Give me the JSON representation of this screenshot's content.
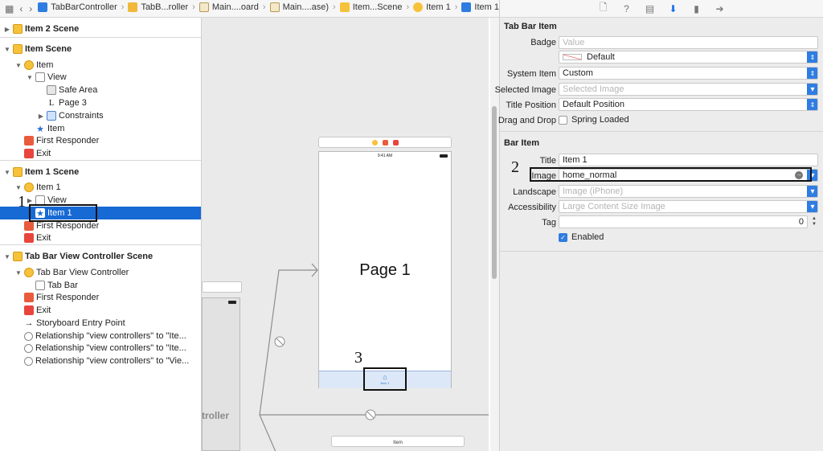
{
  "toolbar": {
    "breadcrumbs": [
      {
        "label": "TabBarController",
        "icon": "project-icon"
      },
      {
        "label": "TabB...roller",
        "icon": "folder-icon"
      },
      {
        "label": "Main....oard",
        "icon": "storyboard-icon"
      },
      {
        "label": "Main....ase)",
        "icon": "storyboard-icon"
      },
      {
        "label": "Item...Scene",
        "icon": "scene-icon"
      },
      {
        "label": "Item 1",
        "icon": "viewcontroller-icon"
      },
      {
        "label": "Item 1",
        "icon": "tabbaritem-icon"
      }
    ]
  },
  "inspector_tabs": [
    "file-icon",
    "help-icon",
    "identity-icon",
    "attributes-icon",
    "size-icon",
    "connections-icon"
  ],
  "outline": {
    "rows": [
      {
        "label": "Item 2 Scene",
        "type": "scene",
        "depth": 0,
        "tri": "▶"
      },
      {
        "label": "Item Scene",
        "type": "scene",
        "depth": 0,
        "tri": "▼"
      },
      {
        "label": "Item",
        "type": "vc",
        "depth": 1,
        "tri": "▼"
      },
      {
        "label": "View",
        "type": "view",
        "depth": 2,
        "tri": "▼"
      },
      {
        "label": "Safe Area",
        "type": "safe",
        "depth": 3,
        "tri": ""
      },
      {
        "label": "Page 3",
        "type": "label",
        "depth": 3,
        "tri": ""
      },
      {
        "label": "Constraints",
        "type": "constraint",
        "depth": 3,
        "tri": "▶"
      },
      {
        "label": "Item",
        "type": "star",
        "depth": 2,
        "tri": ""
      },
      {
        "label": "First Responder",
        "type": "responder",
        "depth": 1,
        "tri": ""
      },
      {
        "label": "Exit",
        "type": "exit",
        "depth": 1,
        "tri": ""
      },
      {
        "label": "Item 1 Scene",
        "type": "scene",
        "depth": 0,
        "tri": "▼"
      },
      {
        "label": "Item 1",
        "type": "vc",
        "depth": 1,
        "tri": "▼"
      },
      {
        "label": "View",
        "type": "view",
        "depth": 2,
        "tri": "▶"
      },
      {
        "label": "Item 1",
        "type": "star",
        "depth": 2,
        "tri": "",
        "selected": true
      },
      {
        "label": "First Responder",
        "type": "responder",
        "depth": 1,
        "tri": ""
      },
      {
        "label": "Exit",
        "type": "exit",
        "depth": 1,
        "tri": ""
      },
      {
        "label": "Tab Bar View Controller Scene",
        "type": "scene",
        "depth": 0,
        "tri": "▼"
      },
      {
        "label": "Tab Bar View Controller",
        "type": "vc",
        "depth": 1,
        "tri": "▼"
      },
      {
        "label": "Tab Bar",
        "type": "tabbar",
        "depth": 2,
        "tri": ""
      },
      {
        "label": "First Responder",
        "type": "responder",
        "depth": 1,
        "tri": ""
      },
      {
        "label": "Exit",
        "type": "exit",
        "depth": 1,
        "tri": ""
      },
      {
        "label": "Storyboard Entry Point",
        "type": "entry",
        "depth": 1,
        "tri": ""
      },
      {
        "label": "Relationship \"view controllers\" to \"Ite...",
        "type": "rel",
        "depth": 1,
        "tri": ""
      },
      {
        "label": "Relationship \"view controllers\" to \"Ite...",
        "type": "rel",
        "depth": 1,
        "tri": ""
      },
      {
        "label": "Relationship \"view controllers\" to \"Vie...",
        "type": "rel",
        "depth": 1,
        "tri": ""
      }
    ]
  },
  "callouts": {
    "one": "1",
    "two": "2",
    "three": "3"
  },
  "canvas": {
    "page_title": "Page 1",
    "status_time": "9:41 AM",
    "tab_item_label": "Item 1",
    "controller_fragment": "troller",
    "bottom_item_label": "Item"
  },
  "inspector": {
    "tab_bar_item": {
      "title": "Tab Bar Item",
      "badge_label": "Badge",
      "badge_placeholder": "Value",
      "badge_color": "Default",
      "system_item_label": "System Item",
      "system_item_value": "Custom",
      "selected_image_label": "Selected Image",
      "selected_image_placeholder": "Selected Image",
      "title_position_label": "Title Position",
      "title_position_value": "Default Position",
      "drag_drop_label": "Drag and Drop",
      "spring_loaded_label": "Spring Loaded",
      "spring_loaded_checked": false
    },
    "bar_item": {
      "title": "Bar Item",
      "title_label": "Title",
      "title_value": "Item 1",
      "image_label": "Image",
      "image_value": "home_normal",
      "landscape_label": "Landscape",
      "landscape_placeholder": "Image (iPhone)",
      "accessibility_label": "Accessibility",
      "accessibility_placeholder": "Large Content Size Image",
      "tag_label": "Tag",
      "tag_value": "0",
      "enabled_label": "Enabled",
      "enabled_checked": true
    }
  },
  "colors": {
    "accent": "#2f7de1",
    "selection": "#1769d4",
    "scene": "#f7c23b",
    "exit": "#e8453d"
  }
}
